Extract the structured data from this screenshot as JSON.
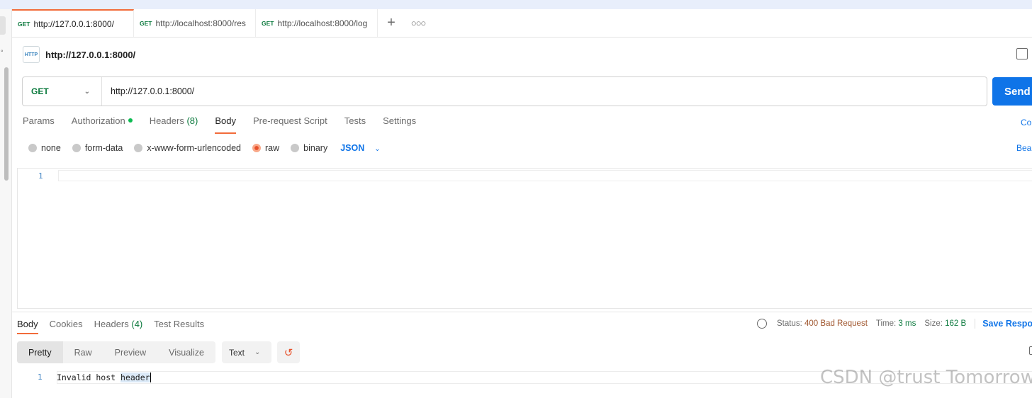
{
  "tabs": [
    {
      "method": "GET",
      "url": "http://127.0.0.1:8000/"
    },
    {
      "method": "GET",
      "url": "http://localhost:8000/res"
    },
    {
      "method": "GET",
      "url": "http://localhost:8000/log"
    }
  ],
  "request": {
    "icon_text": "HTTP",
    "name": "http://127.0.0.1:8000/",
    "method": "GET",
    "url": "http://127.0.0.1:8000/",
    "send_label": "Send"
  },
  "request_tabs": {
    "params": "Params",
    "authorization": "Authorization",
    "headers": "Headers",
    "headers_count": "(8)",
    "body": "Body",
    "prerequest": "Pre-request Script",
    "tests": "Tests",
    "settings": "Settings",
    "cookies_link": "Co"
  },
  "body_options": {
    "none": "none",
    "form_data": "form-data",
    "urlencoded": "x-www-form-urlencoded",
    "raw": "raw",
    "binary": "binary",
    "format": "JSON",
    "beautify": "Bea"
  },
  "editor": {
    "line_number": "1"
  },
  "response_tabs": {
    "body": "Body",
    "cookies": "Cookies",
    "headers": "Headers",
    "headers_count": "(4)",
    "test_results": "Test Results"
  },
  "status": {
    "status_label": "Status:",
    "status_value": "400 Bad Request",
    "time_label": "Time:",
    "time_value": "3 ms",
    "size_label": "Size:",
    "size_value": "162 B",
    "save_response": "Save Respo"
  },
  "view": {
    "pretty": "Pretty",
    "raw": "Raw",
    "preview": "Preview",
    "visualize": "Visualize",
    "format": "Text"
  },
  "response": {
    "line_number": "1",
    "text_plain": "Invalid host ",
    "text_highlight": "header"
  },
  "watermark": "CSDN @trust Tomorrow",
  "colors": {
    "accent": "#f26b3a",
    "send": "#0f74e8",
    "get_method": "#0c7a3e",
    "status_value": "#a0572f"
  }
}
